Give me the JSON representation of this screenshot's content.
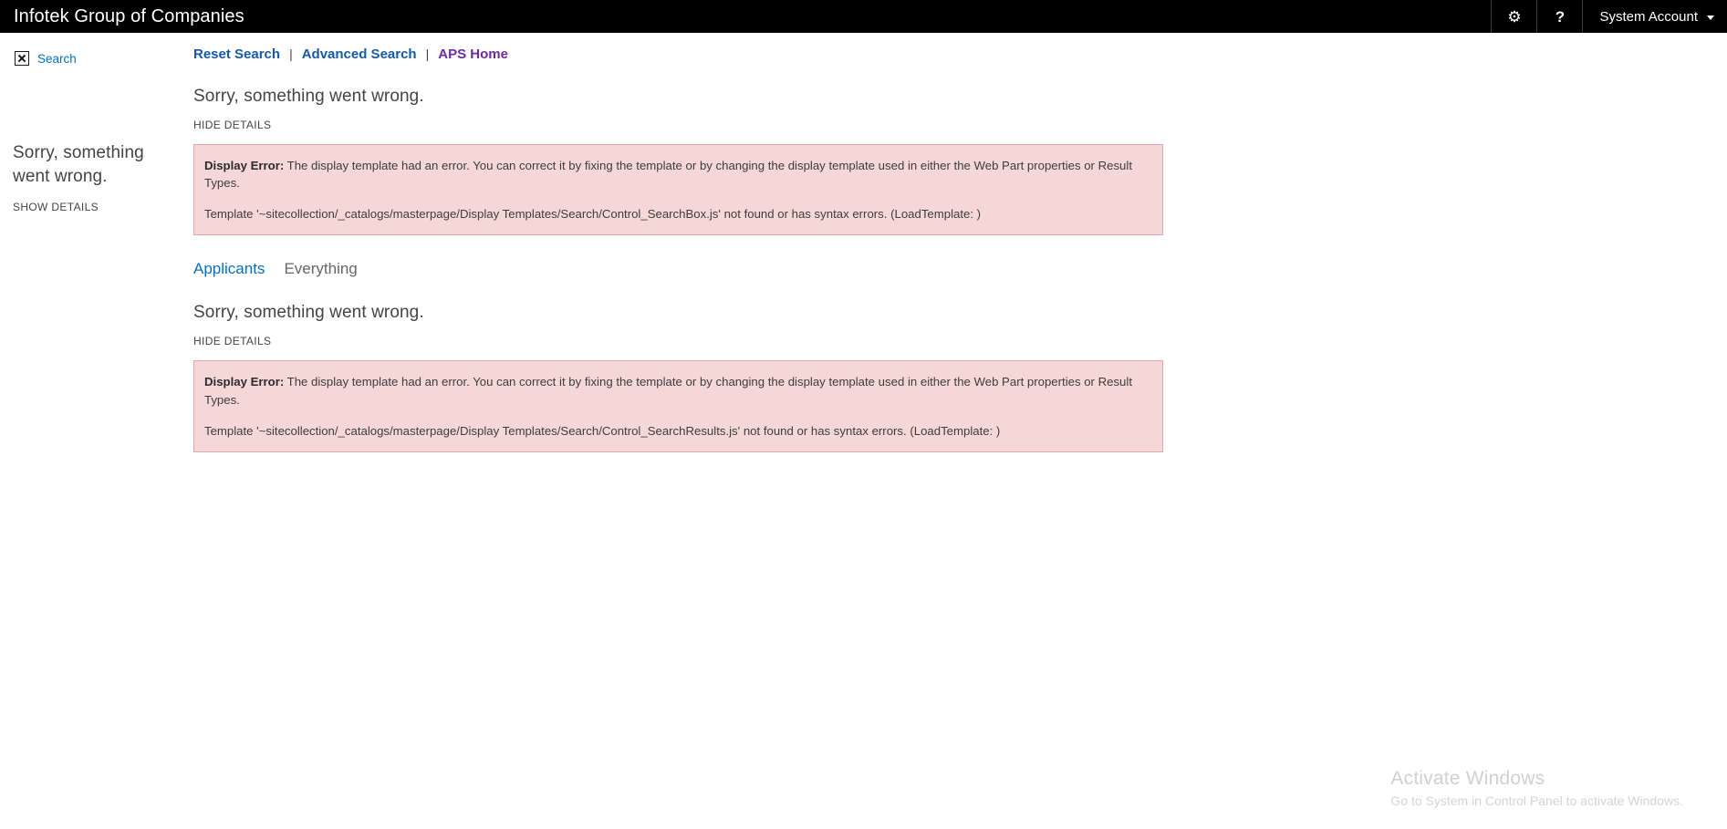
{
  "suite": {
    "site_title": "Infotek Group of Companies",
    "settings_icon": "gear-icon",
    "settings_glyph": "⚙",
    "help_icon": "help-question-icon",
    "help_glyph": "?",
    "account_name": "System Account",
    "account_chevron": "chevron-down-icon"
  },
  "sidebar": {
    "quicklaunch": {
      "icon": "broken-image-icon",
      "label": "Search"
    },
    "error": {
      "heading": "Sorry, something went wrong.",
      "toggle_label": "SHOW DETAILS"
    }
  },
  "search_nav": {
    "reset_label": "Reset Search",
    "advanced_label": "Advanced Search",
    "home_label": "APS Home",
    "separator": "|"
  },
  "searchbox_webpart": {
    "heading": "Sorry, something went wrong.",
    "toggle_label": "HIDE DETAILS",
    "error": {
      "label": "Display Error:",
      "message": "The display template had an error. You can correct it by fixing the template or by changing the display template used in either the Web Part properties or Result Types.",
      "detail": "Template '~sitecollection/_catalogs/masterpage/Display Templates/Search/Control_SearchBox.js' not found or has syntax errors. (LoadTemplate: )"
    }
  },
  "verticals": [
    {
      "label": "Applicants",
      "state": "active"
    },
    {
      "label": "Everything",
      "state": "idle"
    }
  ],
  "results_webpart": {
    "heading": "Sorry, something went wrong.",
    "toggle_label": "HIDE DETAILS",
    "error": {
      "label": "Display Error:",
      "message": "The display template had an error. You can correct it by fixing the template or by changing the display template used in either the Web Part properties or Result Types.",
      "detail": "Template '~sitecollection/_catalogs/masterpage/Display Templates/Search/Control_SearchResults.js' not found or has syntax errors. (LoadTemplate: )"
    }
  },
  "watermark": {
    "title": "Activate Windows",
    "subtitle": "Go to System in Control Panel to activate Windows."
  },
  "colors": {
    "suite_bar": "#000000",
    "link_blue": "#1558b0",
    "link_purple": "#6c2c9e",
    "quicklaunch_blue": "#0072c6",
    "error_bg": "#f6d7d7",
    "error_border": "#e0a8a8",
    "active_vertical": "#0072c6"
  }
}
